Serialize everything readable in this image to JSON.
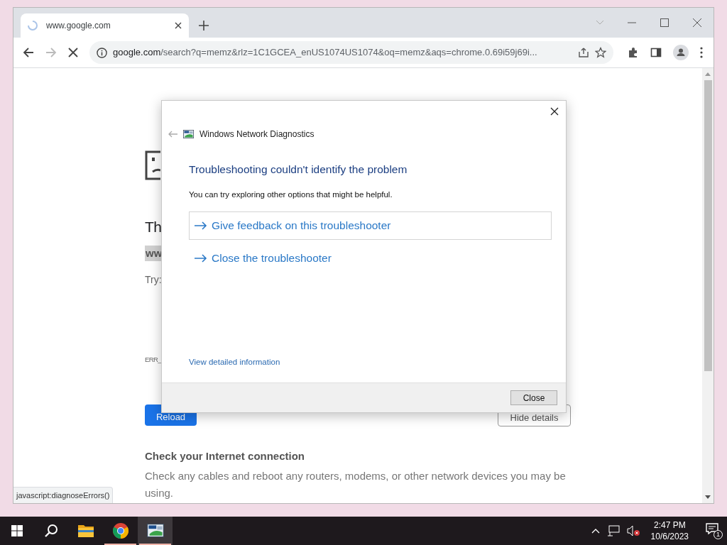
{
  "browser": {
    "tab": {
      "title": "www.google.com",
      "loading": true
    },
    "address": {
      "host": "google.com",
      "path": "/search?q=memz&rlz=1C1GCEA_enUS1074US1074&oq=memz&aqs=chrome.0.69i59j69i..."
    },
    "status_text": "javascript:diagnoseErrors()"
  },
  "page": {
    "partial_title": "Th",
    "partial_url": "ww",
    "partial_try": "Try:",
    "partial_error": "ERR_",
    "reload_button": "Reload",
    "details_button": "Hide details",
    "section_heading": "Check your Internet connection",
    "section_text": "Check any cables and reboot any routers, modems, or other network devices you may be using."
  },
  "dialog": {
    "app_title": "Windows Network Diagnostics",
    "heading": "Troubleshooting couldn't identify the problem",
    "subtext": "You can try exploring other options that might be helpful.",
    "options": [
      {
        "label": "Give feedback on this troubleshooter",
        "hovered": true
      },
      {
        "label": "Close the troubleshooter",
        "hovered": false
      }
    ],
    "details_link": "View detailed information",
    "close_button": "Close"
  },
  "taskbar": {
    "apps": [
      {
        "kind": "folder",
        "running": false,
        "selected": false
      },
      {
        "kind": "chrome",
        "running": true,
        "selected": false
      },
      {
        "kind": "diagnostics",
        "running": true,
        "selected": true
      }
    ],
    "time": "2:47 PM",
    "date": "10/6/2023",
    "notifications": "1"
  }
}
